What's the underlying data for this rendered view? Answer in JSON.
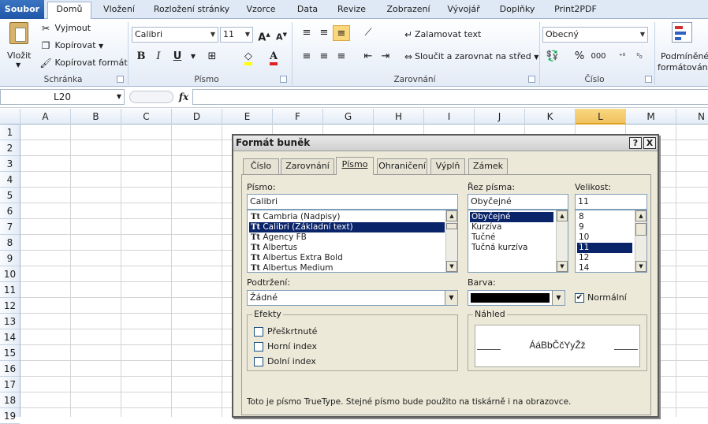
{
  "ribbon_tabs": [
    "Soubor",
    "Domů",
    "Vložení",
    "Rozložení stránky",
    "Vzorce",
    "Data",
    "Revize",
    "Zobrazení",
    "Vývojář",
    "Doplňky",
    "Print2PDF"
  ],
  "clipboard": {
    "paste": "Vložit",
    "cut": "Vyjmout",
    "copy": "Kopírovat",
    "format_painter": "Kopírovat formát",
    "label": "Schránka"
  },
  "font": {
    "name": "Calibri",
    "size": "11",
    "label": "Písmo"
  },
  "alignment": {
    "wrap": "Zalamovat text",
    "merge": "Sloučit a zarovnat na střed",
    "label": "Zarovnání"
  },
  "number": {
    "format": "Obecný",
    "label": "Číslo",
    "percent": "%",
    "thousands": "000"
  },
  "styles": {
    "conditional": "Podmíněné",
    "formatting": "formátování"
  },
  "formula_bar": {
    "name_box": "L20",
    "fx": "fx",
    "content": ""
  },
  "columns": [
    "A",
    "B",
    "C",
    "D",
    "E",
    "F",
    "G",
    "H",
    "I",
    "J",
    "K",
    "L",
    "M",
    "N"
  ],
  "selected_column": "L",
  "rows": [
    "1",
    "2",
    "3",
    "4",
    "5",
    "6",
    "7",
    "8",
    "9",
    "10",
    "11",
    "12",
    "13",
    "14",
    "15",
    "16",
    "17",
    "18",
    "19"
  ],
  "dialog": {
    "title": "Formát buněk",
    "help": "?",
    "close": "X",
    "tabs": [
      "Číslo",
      "Zarovnání",
      "Písmo",
      "Ohraničení",
      "Výplň",
      "Zámek"
    ],
    "active_tab": "Písmo",
    "font_label": "Písmo:",
    "font_value": "Calibri",
    "font_list": [
      "Cambria (Nadpisy)",
      "Calibri (Základní text)",
      "Agency FB",
      "Albertus",
      "Albertus Extra Bold",
      "Albertus Medium"
    ],
    "font_selected": "Calibri (Základní text)",
    "style_label": "Řez písma:",
    "style_value": "Obyčejné",
    "style_list": [
      "Obyčejné",
      "Kurzíva",
      "Tučné",
      "Tučná kurzíva"
    ],
    "style_selected": "Obyčejné",
    "size_label": "Velikost:",
    "size_value": "11",
    "size_list": [
      "8",
      "9",
      "10",
      "11",
      "12",
      "14"
    ],
    "size_selected": "11",
    "underline_label": "Podtržení:",
    "underline_value": "Žádné",
    "color_label": "Barva:",
    "color_value": "#000000",
    "normal_font": "Normální",
    "normal_checked": true,
    "effects_label": "Efekty",
    "strikethrough": "Přeškrtnuté",
    "superscript": "Horní index",
    "subscript": "Dolní index",
    "preview_label": "Náhled",
    "preview_text": "ÁáBbČčYyŽž",
    "note": "Toto je písmo TrueType. Stejné písmo bude použito na tiskárně i na obrazovce."
  }
}
